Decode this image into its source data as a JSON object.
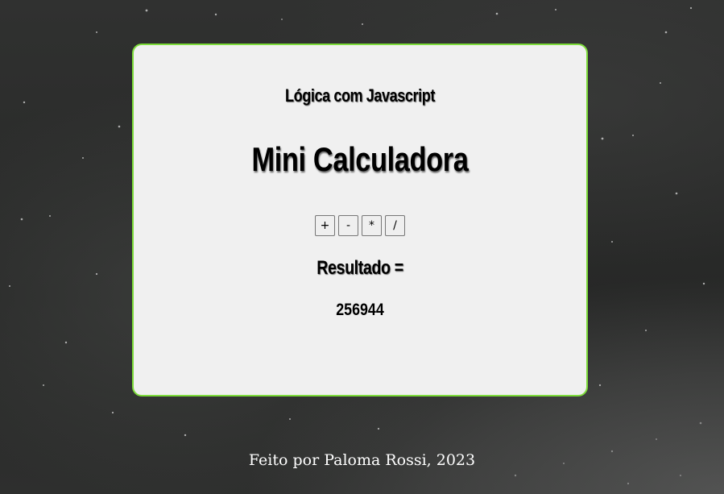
{
  "card": {
    "subtitle": "Lógica com Javascript",
    "title": "Mini Calculadora",
    "operations": [
      {
        "label": "+"
      },
      {
        "label": "-"
      },
      {
        "label": "*"
      },
      {
        "label": "/"
      }
    ],
    "result_label": "Resultado =",
    "result_value": "256944"
  },
  "footer": {
    "text": "Feito por Paloma Rossi, 2023"
  },
  "colors": {
    "card_border": "#7ddc3a",
    "card_background": "#f0f0f0",
    "page_background": "#2b2c2b"
  }
}
